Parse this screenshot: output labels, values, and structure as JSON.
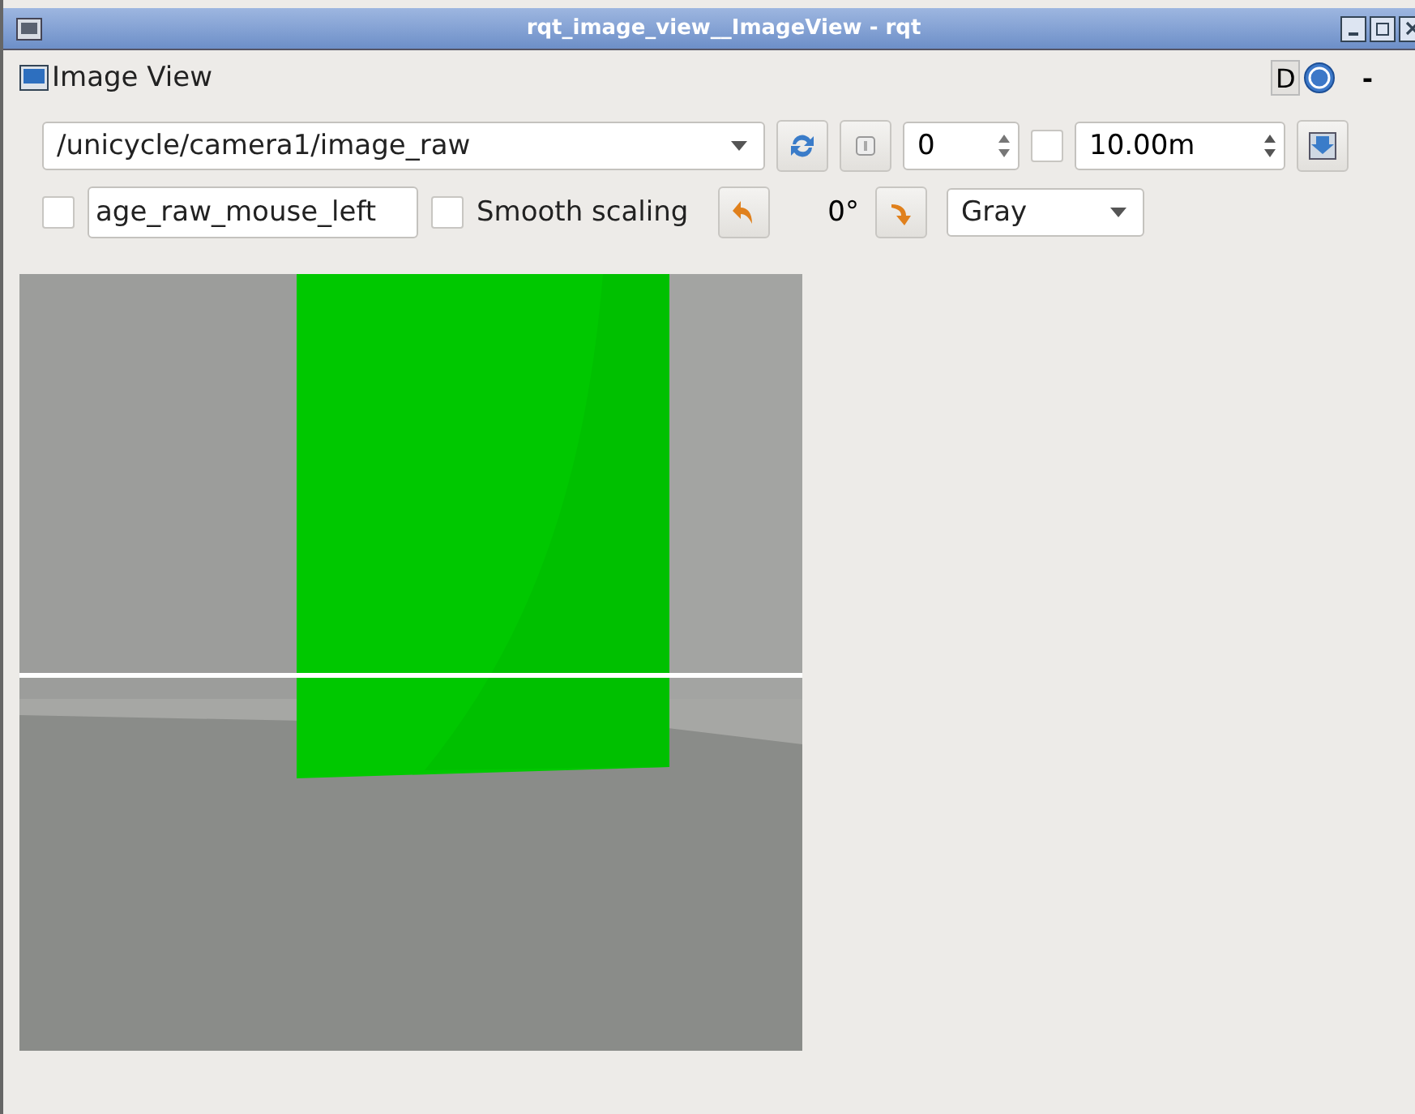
{
  "window": {
    "title": "rqt_image_view__ImageView - rqt"
  },
  "dock": {
    "title": "Image View",
    "d_button": "D",
    "minimize": "-"
  },
  "toolbar": {
    "topic": "/unicycle/camera1/image_raw",
    "zoom_checked": false,
    "zoom_value": "0",
    "dynamic_range_checked": false,
    "max_depth": "10.00m"
  },
  "options": {
    "publish_checked": false,
    "mouse_topic": "age_raw_mouse_left",
    "smooth_scaling": {
      "label": "Smooth scaling",
      "checked": false
    },
    "rotation": "0°",
    "color_scheme": "Gray"
  }
}
